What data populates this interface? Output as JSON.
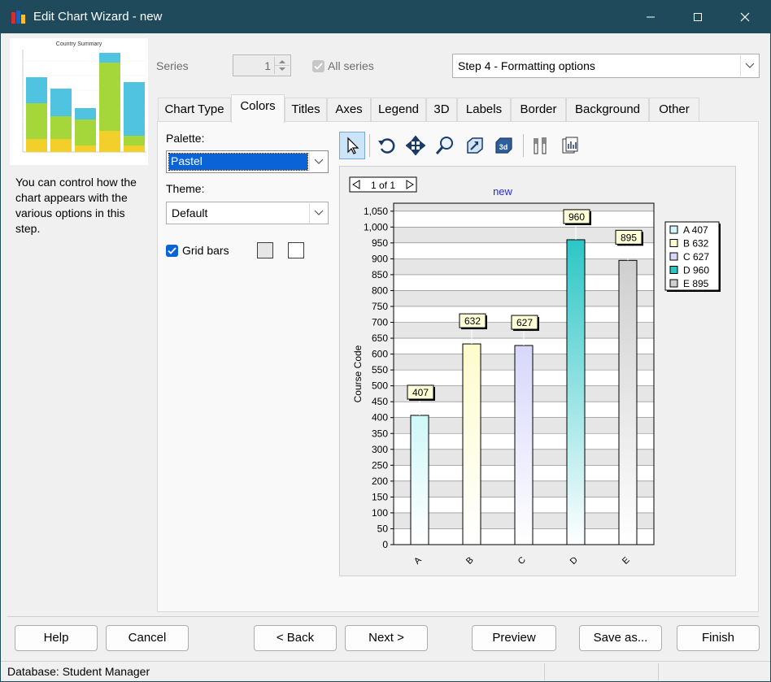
{
  "window": {
    "title": "Edit Chart Wizard - new"
  },
  "preview": {
    "title": "Country Summary"
  },
  "description": "You can control how the chart appears with the various options in this step.",
  "series_row": {
    "series_label": "Series",
    "series_value": "1",
    "all_series_label": "All series",
    "step_select": "Step 4 - Formatting options"
  },
  "tabs": [
    {
      "label": "Chart Type"
    },
    {
      "label": "Colors",
      "active": true
    },
    {
      "label": "Titles"
    },
    {
      "label": "Axes"
    },
    {
      "label": "Legend"
    },
    {
      "label": "3D"
    },
    {
      "label": "Labels"
    },
    {
      "label": "Border"
    },
    {
      "label": "Background"
    },
    {
      "label": "Other"
    }
  ],
  "colors_tab": {
    "palette_label": "Palette:",
    "palette_value": "Pastel",
    "theme_label": "Theme:",
    "theme_value": "Default",
    "grid_bars_label": "Grid bars",
    "grid_bars_checked": true,
    "grid_color_1": "#e6e6e6",
    "grid_color_2": "#ffffff"
  },
  "toolbar": [
    {
      "icon": "pointer-icon"
    },
    {
      "icon": "rotate-icon"
    },
    {
      "icon": "move-icon"
    },
    {
      "icon": "zoom-icon"
    },
    {
      "icon": "resize-icon"
    },
    {
      "icon": "3d-view-icon"
    },
    {
      "icon": "properties-icon"
    },
    {
      "icon": "data-table-icon"
    }
  ],
  "chart_data": {
    "type": "bar",
    "title": "new",
    "page_indicator": "1 of 1",
    "ylabel": "Course Code",
    "xlabel": "",
    "categories": [
      "A",
      "B",
      "C",
      "D",
      "E"
    ],
    "values": [
      407,
      632,
      627,
      960,
      895
    ],
    "ylim": [
      0,
      1075
    ],
    "yticks": [
      0,
      50,
      100,
      150,
      200,
      250,
      300,
      350,
      400,
      450,
      500,
      550,
      600,
      650,
      700,
      750,
      800,
      850,
      900,
      950,
      1000,
      1050
    ],
    "ytick_labels": [
      "0",
      "50",
      "100",
      "150",
      "200",
      "250",
      "300",
      "350",
      "400",
      "450",
      "500",
      "550",
      "600",
      "650",
      "700",
      "750",
      "800",
      "850",
      "900",
      "950",
      "1,000",
      "1,050"
    ],
    "bar_colors": [
      "#cff7f7",
      "#fdfccc",
      "#d7d7fa",
      "#2cc6c6",
      "#cfcfcf"
    ],
    "legend": [
      "A 407",
      "B 632",
      "C 627",
      "D 960",
      "E 895"
    ],
    "legend_position": "right",
    "grid": true
  },
  "buttons": {
    "help": "Help",
    "cancel": "Cancel",
    "back": "< Back",
    "next": "Next >",
    "preview": "Preview",
    "save_as": "Save as...",
    "finish": "Finish"
  },
  "status": {
    "database": "Database: Student Manager"
  }
}
